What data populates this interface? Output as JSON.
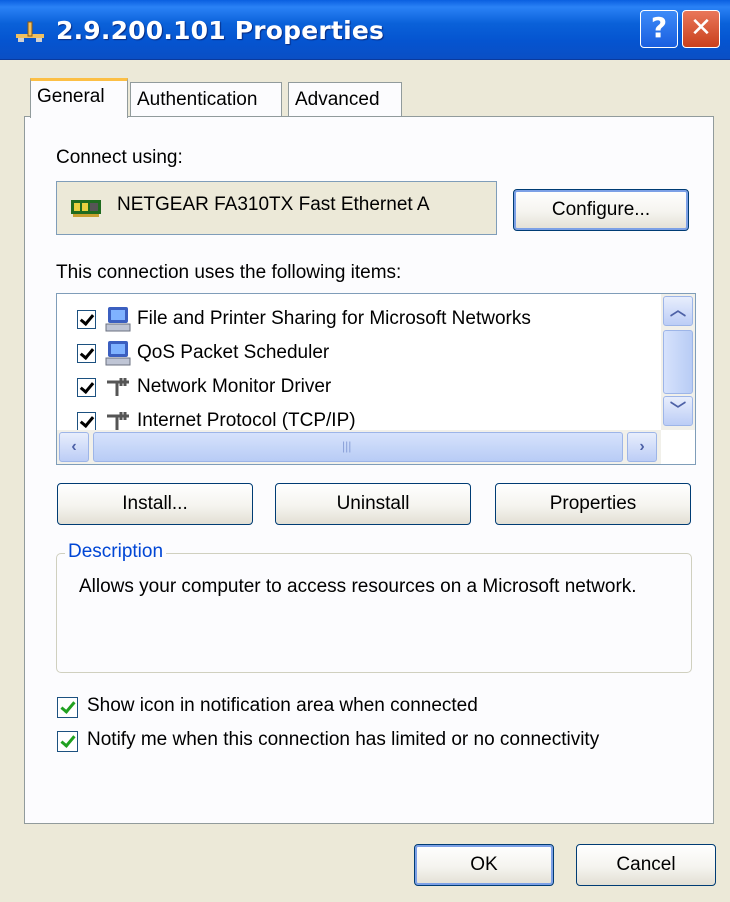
{
  "window": {
    "title": "2.9.200.101 Properties",
    "help_glyph": "?",
    "close_glyph": "✕"
  },
  "tabs": [
    {
      "label": "General",
      "active": true
    },
    {
      "label": "Authentication",
      "active": false
    },
    {
      "label": "Advanced",
      "active": false
    }
  ],
  "general": {
    "connect_using_label": "Connect using:",
    "adapter_name": "NETGEAR FA310TX Fast Ethernet A",
    "configure_label": "Configure...",
    "items_label": "This connection uses the following items:",
    "items": [
      {
        "label": "File and Printer Sharing for Microsoft Networks",
        "checked": true,
        "icon": "computer-icon"
      },
      {
        "label": "QoS Packet Scheduler",
        "checked": true,
        "icon": "computer-icon"
      },
      {
        "label": "Network Monitor Driver",
        "checked": true,
        "icon": "protocol-icon"
      },
      {
        "label": "Internet Protocol (TCP/IP)",
        "checked": true,
        "icon": "protocol-icon"
      }
    ],
    "install_label": "Install...",
    "uninstall_label": "Uninstall",
    "properties_label": "Properties",
    "description_title": "Description",
    "description_text": "Allows your computer to access resources on a Microsoft network.",
    "show_icon_label": "Show icon in notification area when connected",
    "show_icon_checked": true,
    "notify_label": "Notify me when this connection has limited or no connectivity",
    "notify_checked": true
  },
  "footer": {
    "ok_label": "OK",
    "cancel_label": "Cancel"
  }
}
